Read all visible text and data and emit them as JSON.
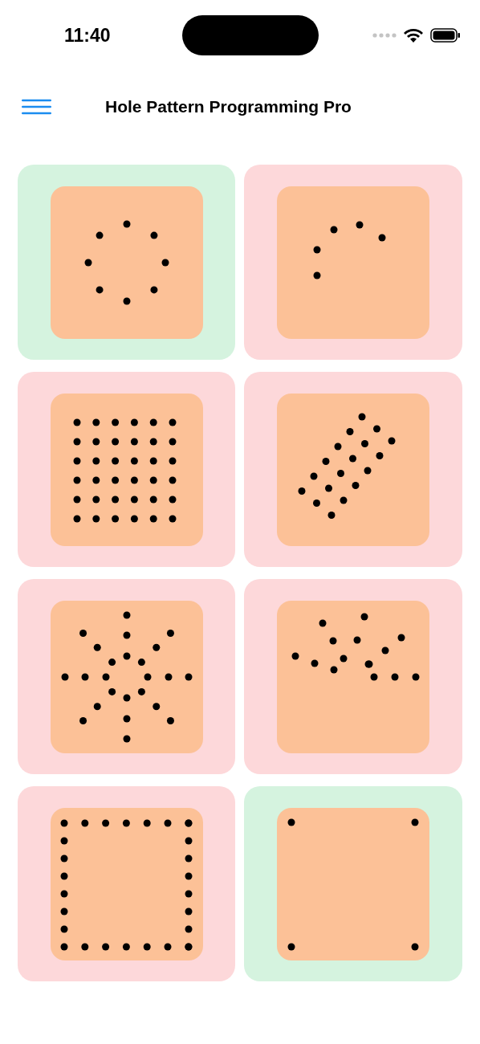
{
  "status_bar": {
    "time": "11:40"
  },
  "header": {
    "title": "Hole Pattern Programming Pro"
  },
  "patterns": [
    {
      "kind": "bolt-circle",
      "color": "#d5f3df"
    },
    {
      "kind": "arc",
      "color": "#fdd8da"
    },
    {
      "kind": "grid",
      "color": "#fdd8da"
    },
    {
      "kind": "angled-grid",
      "color": "#fdd8da"
    },
    {
      "kind": "radial",
      "color": "#fdd8da"
    },
    {
      "kind": "partial-radial",
      "color": "#fdd8da"
    },
    {
      "kind": "frame",
      "color": "#fdd8da"
    },
    {
      "kind": "corners",
      "color": "#d5f3df"
    }
  ]
}
